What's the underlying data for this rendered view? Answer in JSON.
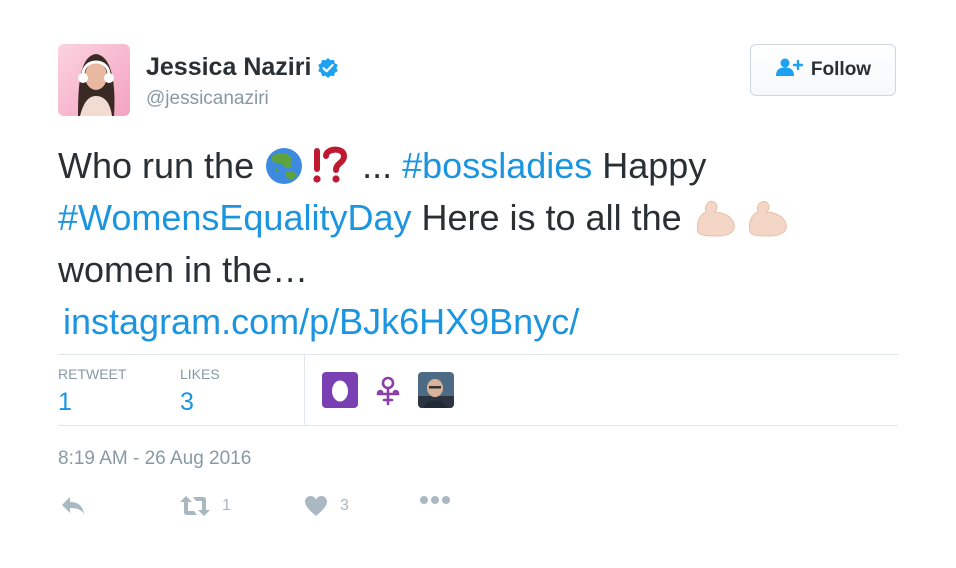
{
  "user": {
    "name": "Jessica Naziri",
    "handle": "@jessicanaziri",
    "verified": true
  },
  "follow_button": {
    "label": "Follow",
    "icon": "follow-person-plus-icon"
  },
  "tweet": {
    "line1": {
      "t1": "Who run the ",
      "t2": "... ",
      "hashtag": "#bossladies",
      "t3": " Happy"
    },
    "line2": {
      "hashtag": "#WomensEqualityDay",
      "t1": " Here is to all the "
    },
    "line3": {
      "t1": "women in the…"
    },
    "line4": {
      "link": "instagram.com/p/BJk6HX9Bnyc/"
    },
    "emojis": [
      "globe-asia-australia-icon",
      "exclamation-question-mark-icon",
      "flexed-biceps-icon"
    ]
  },
  "stats": {
    "retweet_label": "RETWEET",
    "retweet_count": "1",
    "likes_label": "LIKES",
    "likes_count": "3"
  },
  "likers": [
    "egg-avatar",
    "prince-symbol-avatar",
    "man-photo-avatar"
  ],
  "timestamp": "8:19 AM - 26 Aug 2016",
  "actions": {
    "reply_icon": "reply-icon",
    "retweet_icon": "retweet-icon",
    "retweet_count": "1",
    "like_icon": "heart-icon",
    "like_count": "3",
    "more_icon": "more-dots-icon"
  },
  "colors": {
    "link": "#1b95e0",
    "text": "#292f33",
    "muted": "#8899a6",
    "border": "#e1e8ed",
    "verified": "#1da1f2"
  }
}
